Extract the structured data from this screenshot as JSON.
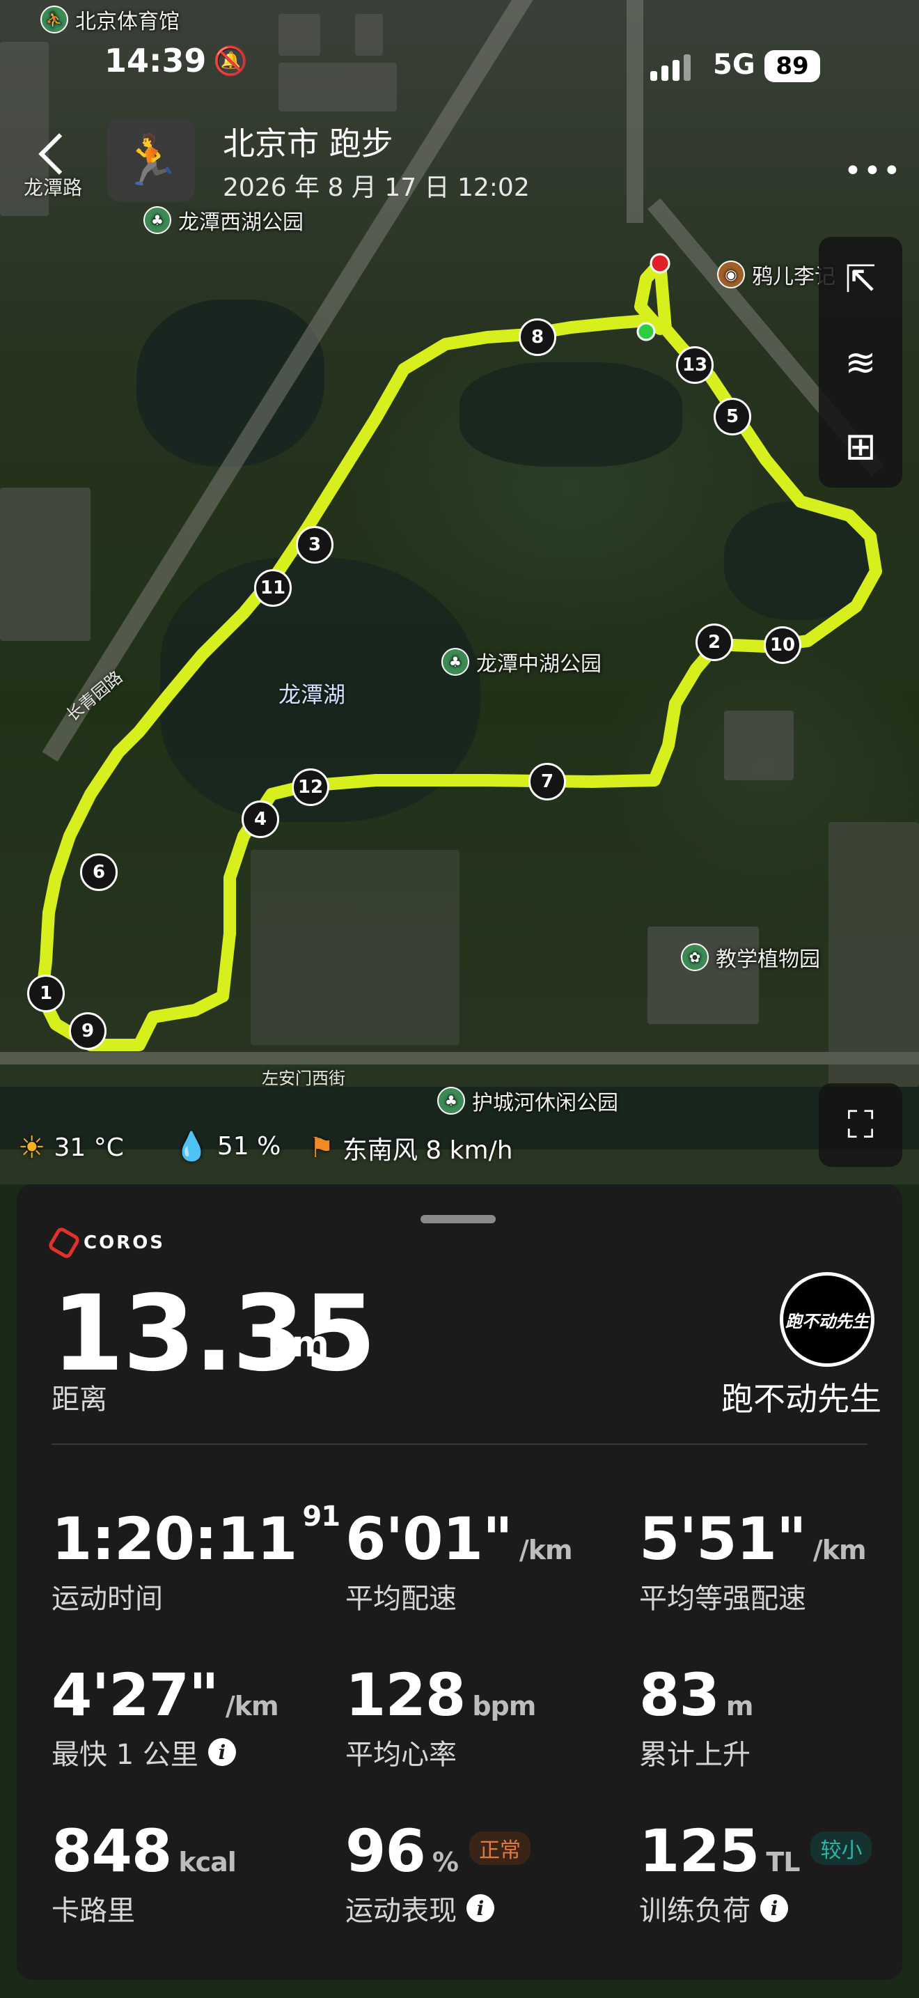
{
  "status_bar": {
    "time": "14:39",
    "network": "5G",
    "battery": "89"
  },
  "header": {
    "title": "北京市 跑步",
    "datetime": "2026 年 8 月 17 日 12:02"
  },
  "map": {
    "pois": {
      "stadium": "北京体育馆",
      "longtanlu": "龙潭路",
      "west_park": "龙潭西湖公园",
      "yaerli": "鸦儿李记",
      "middle_park": "龙潭中湖公园",
      "lake": "龙潭湖",
      "changqing": "长青园路",
      "botanic": "教学植物园",
      "street": "左安门西街",
      "moat_park": "护城河休闲公园"
    },
    "km_markers": [
      "1",
      "2",
      "3",
      "4",
      "5",
      "6",
      "7",
      "8",
      "9",
      "10",
      "11",
      "12",
      "13"
    ],
    "route_color": "#d7ef1c",
    "start_color": "#2ecc40",
    "end_color": "#e0212a"
  },
  "weather": {
    "temp": "31 °C",
    "humidity": "51 %",
    "wind": "东南风 8 km/h"
  },
  "panel": {
    "brand": "COROS",
    "distance_value": "13.35",
    "distance_unit": "km",
    "distance_label": "距离",
    "avatar_text": "跑不动先生",
    "username": "跑不动先生",
    "stats": {
      "time_value": "1:20:11",
      "time_sup": "91",
      "time_label": "运动时间",
      "pace_value": "6'01\"",
      "pace_unit": "/km",
      "pace_label": "平均配速",
      "grade_pace_value": "5'51\"",
      "grade_pace_unit": "/km",
      "grade_pace_label": "平均等强配速",
      "fastest_value": "4'27\"",
      "fastest_unit": "/km",
      "fastest_label": "最快 1 公里",
      "hr_value": "128",
      "hr_unit": "bpm",
      "hr_label": "平均心率",
      "ascent_value": "83",
      "ascent_unit": "m",
      "ascent_label": "累计上升",
      "cal_value": "848",
      "cal_unit": "kcal",
      "cal_label": "卡路里",
      "perf_value": "96",
      "perf_unit": "%",
      "perf_badge": "正常",
      "perf_label": "运动表现",
      "load_value": "125",
      "load_unit": "TL",
      "load_badge": "较小",
      "load_label": "训练负荷"
    },
    "badge_colors": {
      "perf": "#e07a3a",
      "load": "#2bb5a8"
    }
  }
}
